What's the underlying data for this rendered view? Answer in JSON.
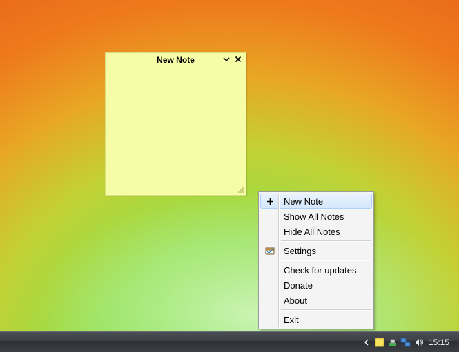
{
  "note": {
    "title": "New Note",
    "body": ""
  },
  "context_menu": {
    "items": [
      {
        "label": "New Note",
        "icon": "plus-icon",
        "highlighted": true
      },
      {
        "label": "Show All Notes",
        "icon": null,
        "highlighted": false
      },
      {
        "label": "Hide All Notes",
        "icon": null,
        "highlighted": false
      },
      {
        "separator": true
      },
      {
        "label": "Settings",
        "icon": "settings-icon",
        "highlighted": false
      },
      {
        "separator": true
      },
      {
        "label": "Check for updates",
        "icon": null,
        "highlighted": false
      },
      {
        "label": "Donate",
        "icon": null,
        "highlighted": false
      },
      {
        "label": "About",
        "icon": null,
        "highlighted": false
      },
      {
        "separator": true
      },
      {
        "label": "Exit",
        "icon": null,
        "highlighted": false
      }
    ]
  },
  "taskbar": {
    "clock": "15:15"
  }
}
